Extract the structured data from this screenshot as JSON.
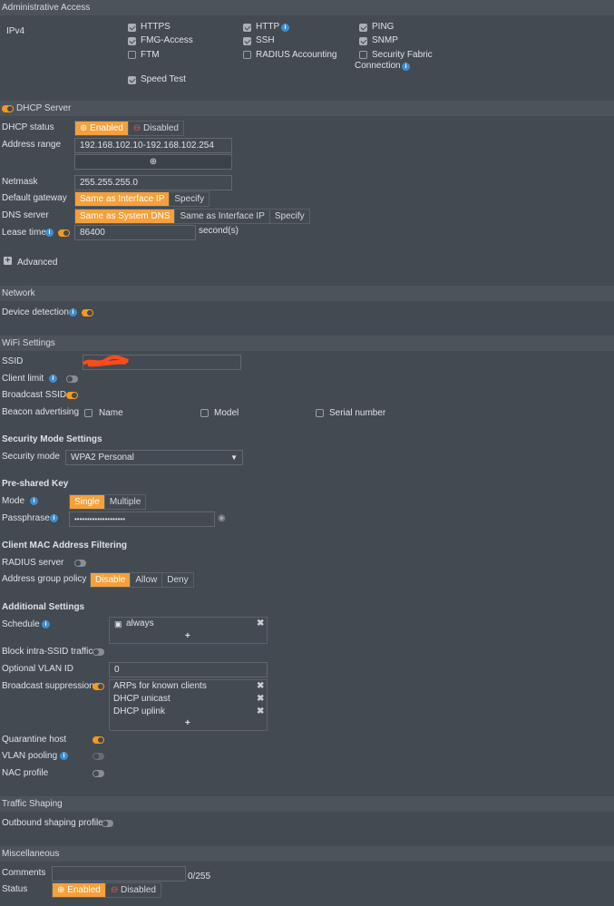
{
  "admin_access": {
    "title": "Administrative Access",
    "ipv4_label": "IPv4",
    "options": [
      {
        "label": "HTTPS",
        "checked": true
      },
      {
        "label": "FMG-Access",
        "checked": true
      },
      {
        "label": "FTM",
        "checked": false
      },
      {
        "label": "Speed Test",
        "checked": true
      },
      {
        "label": "HTTP",
        "checked": true
      },
      {
        "label": "SSH",
        "checked": true
      },
      {
        "label": "RADIUS Accounting",
        "checked": false
      },
      {
        "label": "PING",
        "checked": true
      },
      {
        "label": "SNMP",
        "checked": true
      },
      {
        "label": "Security Fabric",
        "label2": "Connection",
        "checked": false
      }
    ]
  },
  "dhcp": {
    "title": "DHCP Server",
    "enabled": true,
    "status_label": "DHCP status",
    "enabled_label": "Enabled",
    "disabled_label": "Disabled",
    "address_range_label": "Address range",
    "address_range": "192.168.102.10-192.168.102.254",
    "netmask_label": "Netmask",
    "netmask": "255.255.255.0",
    "gateway_label": "Default gateway",
    "gateway_options": [
      "Same as Interface IP",
      "Specify"
    ],
    "dns_label": "DNS server",
    "dns_options": [
      "Same as System DNS",
      "Same as Interface IP",
      "Specify"
    ],
    "lease_label": "Lease time",
    "lease_value": "86400",
    "lease_unit": "second(s)",
    "advanced_label": "Advanced"
  },
  "network": {
    "title": "Network",
    "device_detection_label": "Device detection",
    "device_detection": true
  },
  "wifi": {
    "title": "WiFi Settings",
    "ssid_label": "SSID",
    "client_limit_label": "Client limit",
    "broadcast_ssid_label": "Broadcast SSID",
    "beacon_label": "Beacon advertising",
    "beacon_options": [
      "Name",
      "Model",
      "Serial number"
    ]
  },
  "security": {
    "title": "Security Mode Settings",
    "mode_label": "Security mode",
    "mode_value": "WPA2 Personal"
  },
  "psk": {
    "title": "Pre-shared Key",
    "mode_label": "Mode",
    "mode_options": [
      "Single",
      "Multiple"
    ],
    "passphrase_label": "Passphrase",
    "passphrase": "••••••••••••••••••••"
  },
  "mac_filter": {
    "title": "Client MAC Address Filtering",
    "radius_label": "RADIUS server",
    "policy_label": "Address group policy",
    "policy_options": [
      "Disable",
      "Allow",
      "Deny"
    ]
  },
  "additional": {
    "title": "Additional Settings",
    "schedule_label": "Schedule",
    "schedule_value": "always",
    "block_label": "Block intra-SSID traffic",
    "vlan_label": "Optional VLAN ID",
    "vlan_value": "0",
    "bcast_label": "Broadcast suppression",
    "bcast_items": [
      "ARPs for known clients",
      "DHCP unicast",
      "DHCP uplink"
    ],
    "quarantine_label": "Quarantine host",
    "vlan_pool_label": "VLAN pooling",
    "nac_label": "NAC profile"
  },
  "traffic": {
    "title": "Traffic Shaping",
    "outbound_label": "Outbound shaping profile"
  },
  "misc": {
    "title": "Miscellaneous",
    "comments_label": "Comments",
    "comments_count": "0/255",
    "status_label": "Status",
    "enabled_label": "Enabled",
    "disabled_label": "Disabled"
  },
  "colors": {
    "accent": "#f5a03a",
    "background": "#434a52",
    "info": "#3f8fd0"
  }
}
